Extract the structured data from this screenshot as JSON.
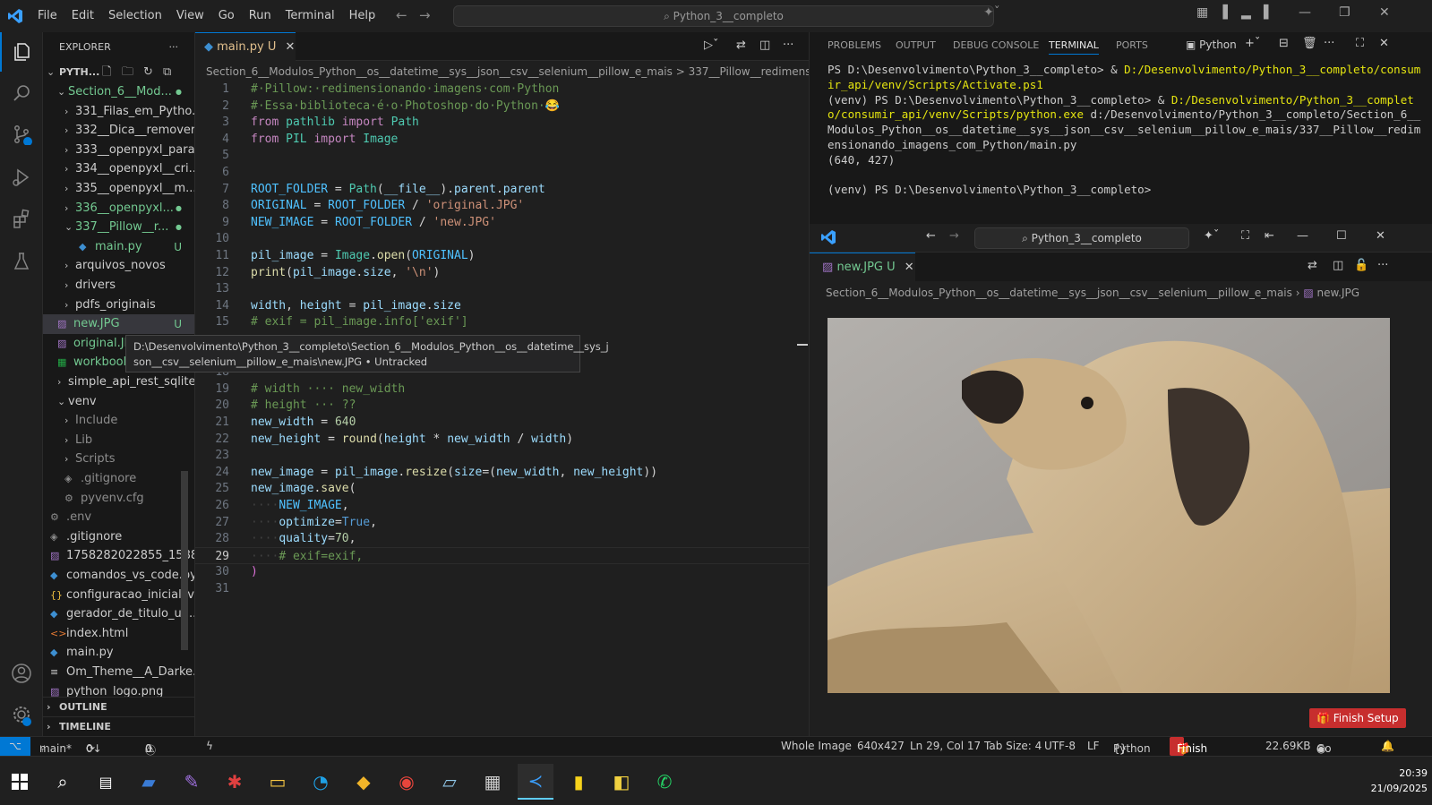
{
  "window": {
    "search": "Python_3__completo"
  },
  "menu": [
    "File",
    "Edit",
    "Selection",
    "View",
    "Go",
    "Run",
    "Terminal",
    "Help"
  ],
  "explorer": {
    "title": "EXPLORER",
    "root": "PYTH...",
    "items": [
      {
        "label": "Section_6__Mod...",
        "badge": "●",
        "badge_color": "#73c991",
        "label_color": "#73c991"
      },
      {
        "label": "331_Filas_em_Pytho...",
        "badge": "",
        "label_color": "#cccccc"
      },
      {
        "label": "332__Dica__remover...",
        "badge": "",
        "label_color": "#cccccc"
      },
      {
        "label": "333__openpyxl_para...",
        "badge": "",
        "label_color": "#cccccc"
      },
      {
        "label": "334__openpyxl__cri...",
        "badge": "",
        "label_color": "#cccccc"
      },
      {
        "label": "335__openpyxl__m...",
        "badge": "",
        "label_color": "#cccccc"
      },
      {
        "label": "336__openpyxl...",
        "badge": "●",
        "badge_color": "#73c991",
        "label_color": "#73c991"
      },
      {
        "label": "337__Pillow__r...",
        "badge": "●",
        "badge_color": "#73c991",
        "label_color": "#73c991"
      },
      {
        "label": "main.py",
        "badge": "U",
        "badge_color": "#73c991",
        "label_color": "#73c991"
      },
      {
        "label": "arquivos_novos",
        "badge": "",
        "label_color": "#cccccc"
      },
      {
        "label": "drivers",
        "badge": "",
        "label_color": "#cccccc"
      },
      {
        "label": "pdfs_originais",
        "badge": "",
        "label_color": "#cccccc"
      },
      {
        "label": "new.JPG",
        "badge": "U",
        "badge_color": "#73c991",
        "label_color": "#73c991"
      },
      {
        "label": "original.JPG",
        "badge": "",
        "label_color": "#73c991"
      },
      {
        "label": "workbook",
        "badge": "",
        "label_color": "#73c991"
      },
      {
        "label": "simple_api_rest_sqlite...",
        "badge": "",
        "label_color": "#cccccc"
      },
      {
        "label": "venv",
        "badge": "",
        "label_color": "#cccccc"
      },
      {
        "label": "Include",
        "badge": "",
        "label_color": "#8c8c8c"
      },
      {
        "label": "Lib",
        "badge": "",
        "label_color": "#8c8c8c"
      },
      {
        "label": "Scripts",
        "badge": "",
        "label_color": "#8c8c8c"
      },
      {
        "label": ".gitignore",
        "badge": "",
        "label_color": "#8c8c8c"
      },
      {
        "label": "pyvenv.cfg",
        "badge": "",
        "label_color": "#8c8c8c"
      },
      {
        "label": ".env",
        "badge": "",
        "label_color": "#8c8c8c"
      },
      {
        "label": ".gitignore",
        "badge": "",
        "label_color": "#cccccc"
      },
      {
        "label": "1758282022855_1588...",
        "badge": "",
        "label_color": "#cccccc"
      },
      {
        "label": "comandos_vs_code.py",
        "badge": "",
        "label_color": "#cccccc"
      },
      {
        "label": "configuracao_inicial_v...",
        "badge": "",
        "label_color": "#cccccc"
      },
      {
        "label": "gerador_de_titulo_un...",
        "badge": "",
        "label_color": "#cccccc"
      },
      {
        "label": "index.html",
        "badge": "",
        "label_color": "#cccccc"
      },
      {
        "label": "main.py",
        "badge": "",
        "label_color": "#cccccc"
      },
      {
        "label": "Om_Theme__A_Darke...",
        "badge": "",
        "label_color": "#cccccc"
      },
      {
        "label": "python_logo.png",
        "badge": "",
        "label_color": "#cccccc"
      }
    ],
    "outline": "OUTLINE",
    "timeline": "TIMELINE"
  },
  "editor": {
    "tab_label": "main.py",
    "tab_badge": "U",
    "breadcrumb": "Section_6__Modulos_Python__os__datetime__sys__json__csv__selenium__pillow_e_mais > 337__Pillow__redimensionando_i",
    "line_numbers": [
      "1",
      "2",
      "3",
      "4",
      "5",
      "6",
      "7",
      "8",
      "9",
      "10",
      "11",
      "12",
      "13",
      "14",
      "15",
      "18",
      "19",
      "20",
      "21",
      "22",
      "23",
      "24",
      "25",
      "26",
      "27",
      "28",
      "29",
      "30",
      "31"
    ]
  },
  "tooltip": {
    "line1": "D:\\Desenvolvimento\\Python_3__completo\\Section_6__Modulos_Python__os__datetime__sys_j",
    "line2": "son__csv__selenium__pillow_e_mais\\new.JPG • Untracked"
  },
  "panel": {
    "tabs": [
      "PROBLEMS",
      "OUTPUT",
      "DEBUG CONSOLE",
      "TERMINAL",
      "PORTS"
    ],
    "shell": "Python",
    "terminal": {
      "l1a": "PS D:\\Desenvolvimento\\Python_3__completo> ",
      "l1b": "& ",
      "l1c": "D:/Desenvolvimento/Python_3__completo/consumir_api/venv/Scripts/Activate.ps1",
      "l2a": "(venv) PS D:\\Desenvolvimento\\Python_3__completo> ",
      "l2b": "& ",
      "l2c": "D:/Desenvolvimento/Python_3__completo/consumir_api/venv/Scripts/python.exe",
      "l2d": " d:/Desenvolvimento/Python_3__completo/Section_6__Modulos_Python__os__datetime__sys__json__csv__selenium__pillow_e_mais/337__Pillow__redimensionando_imagens_com_Python/main.py",
      "l3": "(640, 427)",
      "l4": "(venv) PS D:\\Desenvolvimento\\Python_3__completo>"
    }
  },
  "image_window": {
    "search": "Python_3__completo",
    "tab_label": "new.JPG",
    "tab_badge": "U",
    "breadcrumb": "Section_6__Modulos_Python__os__datetime__sys__json__csv__selenium__pillow_e_mais",
    "breadcrumb_file": "new.JPG",
    "finish_setup": "Finish Setup"
  },
  "statusbar": {
    "branch": "main*",
    "sync": "0↓ 12↑",
    "errors": "0",
    "warnings": "0",
    "whole_image": "Whole Image",
    "dims": "640x427",
    "position": "Ln 29, Col 17",
    "tab_size": "Tab Size: 4",
    "encoding": "UTF-8",
    "eol": "LF",
    "language": "Python",
    "finish_setup": "Finish Setup",
    "file_size": "22.69KB",
    "go_live": "Go Live"
  },
  "taskbar": {
    "time": "20:39",
    "date": "21/09/2025"
  },
  "colors": {
    "accent": "#0078d4",
    "git_added": "#73c991",
    "finish_setup": "#c72e2e"
  }
}
